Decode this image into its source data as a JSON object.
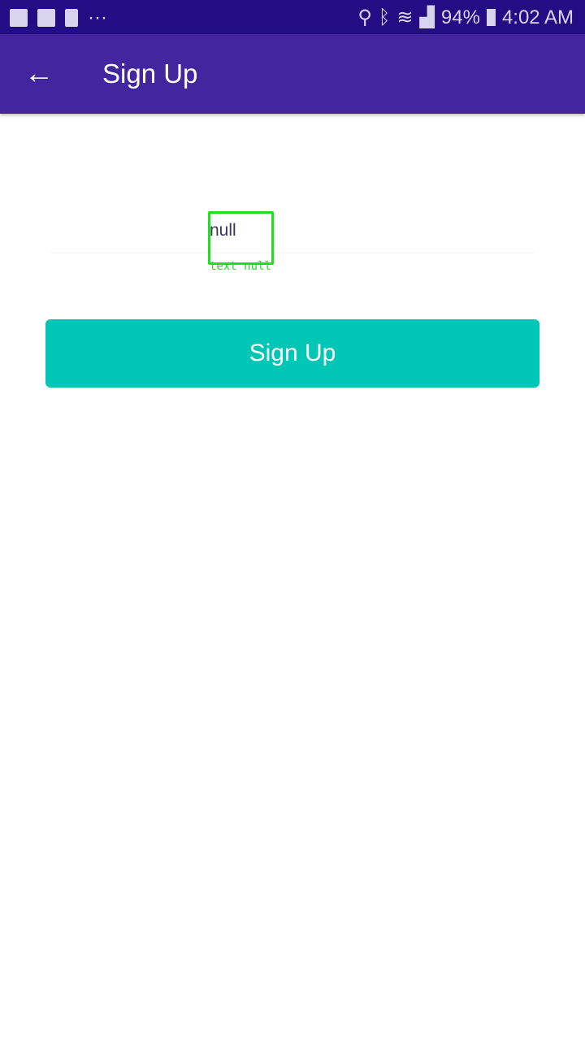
{
  "status": {
    "battery": "94%",
    "time": "4:02 AM",
    "more": "···"
  },
  "appbar": {
    "title": "Sign Up",
    "back": "←"
  },
  "form": {
    "field_value": "null",
    "debug_label": "text null",
    "submit_label": "Sign Up"
  },
  "colors": {
    "status": "#240c84",
    "appbar": "#43259e",
    "button": "#00c6b5"
  }
}
